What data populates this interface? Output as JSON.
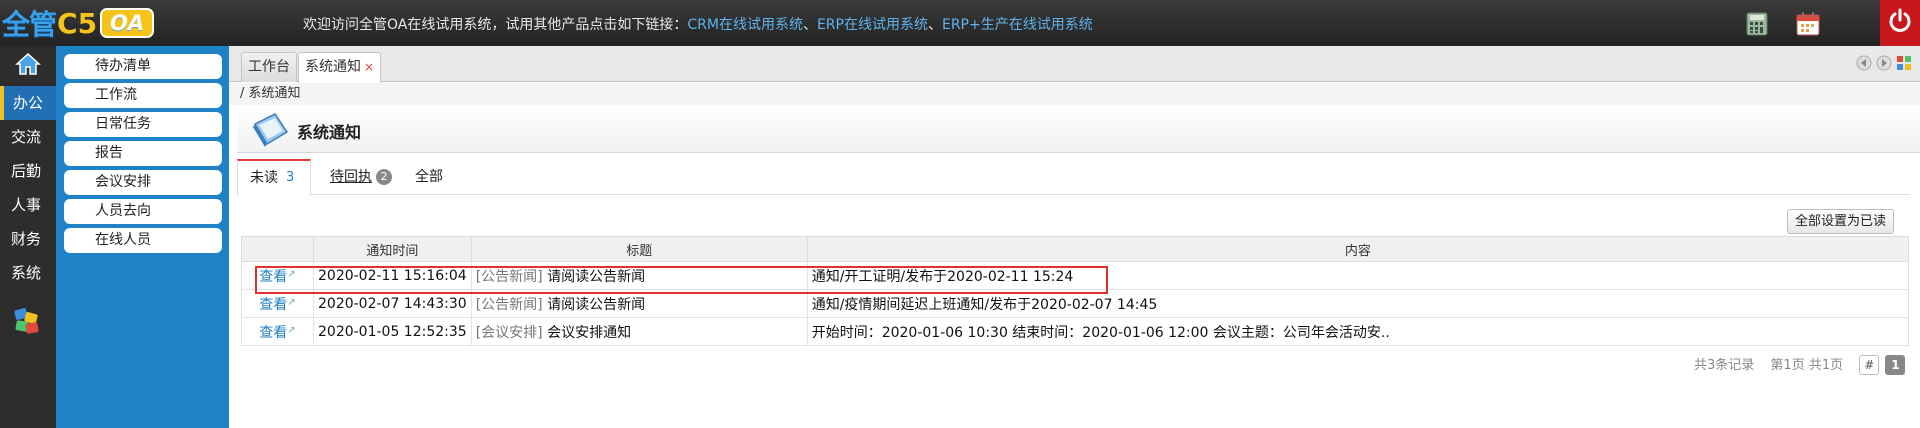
{
  "header": {
    "brand": "全管",
    "brand_c5": "C5",
    "brand_oa": "OA",
    "welcome_prefix": "欢迎访问全管OA在线试用系统，试用其他产品点击如下链接：",
    "links": [
      "CRM在线试用系统",
      "ERP在线试用系统",
      "ERP+生产在线试用系统"
    ],
    "link_sep": "、",
    "icons": [
      "calculator-icon",
      "calendar-icon",
      "power-icon"
    ],
    "power_color": "#c8171c"
  },
  "leftnav": {
    "items": [
      "办公",
      "交流",
      "后勤",
      "人事",
      "财务",
      "系统"
    ],
    "active": "办公",
    "accent": "#236fb3"
  },
  "submenu": {
    "items": [
      "待办清单",
      "工作流",
      "日常任务",
      "报告",
      "会议安排",
      "人员去向",
      "在线人员"
    ]
  },
  "tabs": [
    {
      "label": "工作台"
    },
    {
      "label": "系统通知",
      "close": "×"
    }
  ],
  "breadcrumb": "/ 系统通知",
  "page_title": "系统通知",
  "subtabs": [
    {
      "label": "未读",
      "count": "3"
    },
    {
      "label": "待回执",
      "count": "2"
    },
    {
      "label": "全部"
    }
  ],
  "mark_all_read": "全部设置为已读",
  "table": {
    "columns": [
      "",
      "通知时间",
      "标题",
      "内容"
    ],
    "rows": [
      {
        "action": "查看",
        "time": "2020-02-11 15:16:04",
        "category": "[公告新闻]",
        "title": "请阅读公告新闻",
        "content": "通知/开工证明/发布于2020-02-11 15:24"
      },
      {
        "action": "查看",
        "time": "2020-02-07 14:43:30",
        "category": "[公告新闻]",
        "title": "请阅读公告新闻",
        "content": "通知/疫情期间延迟上班通知/发布于2020-02-07 14:45"
      },
      {
        "action": "查看",
        "time": "2020-01-05 12:52:35",
        "category": "[会议安排]",
        "title": "会议安排通知",
        "content": "开始时间：2020-01-06 10:30 结束时间：2020-01-06 12:00 会议主题：公司年会活动安.."
      }
    ]
  },
  "pager": {
    "total": "共3条记录",
    "pages": "第1页 共1页",
    "hash": "#",
    "current": "1"
  }
}
